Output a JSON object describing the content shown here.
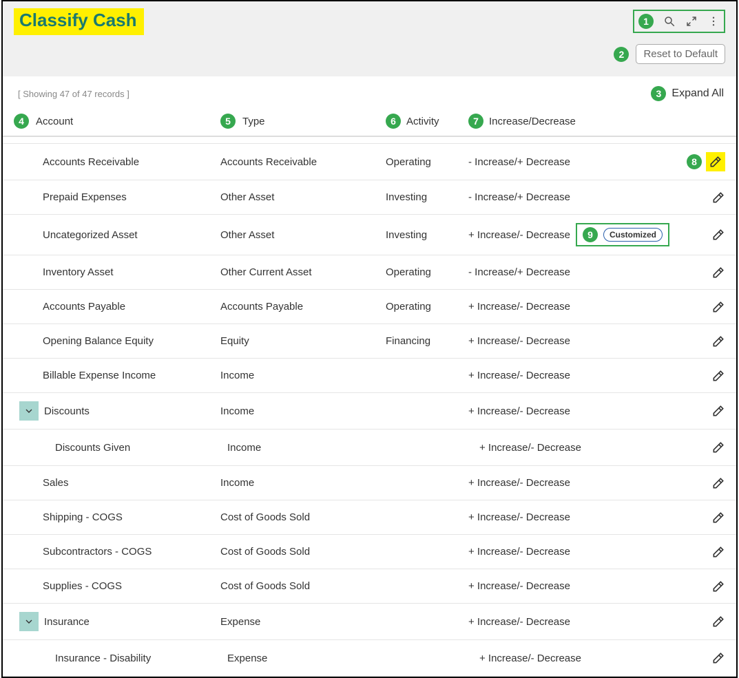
{
  "header": {
    "title": "Classify Cash",
    "reset_label": "Reset to Default"
  },
  "callouts": {
    "toolbar": "1",
    "reset": "2",
    "expand": "3",
    "account": "4",
    "type": "5",
    "activity": "6",
    "incdec": "7",
    "edit": "8",
    "customized": "9"
  },
  "subheader": {
    "record_count": "[ Showing 47 of 47 records ]",
    "expand_all": "Expand All"
  },
  "columns": {
    "account": "Account",
    "type": "Type",
    "activity": "Activity",
    "incdec": "Increase/Decrease"
  },
  "badges": {
    "customized": "Customized"
  },
  "rows": [
    {
      "account": "Accounts Receivable",
      "type": "Accounts Receivable",
      "activity": "Operating",
      "incdec": "- Increase/+ Decrease",
      "indent": 1,
      "first_edit": true
    },
    {
      "account": "Prepaid Expenses",
      "type": "Other Asset",
      "activity": "Investing",
      "incdec": "- Increase/+ Decrease",
      "indent": 1
    },
    {
      "account": "Uncategorized Asset",
      "type": "Other Asset",
      "activity": "Investing",
      "incdec": "+ Increase/- Decrease",
      "indent": 1,
      "customized": true
    },
    {
      "account": "Inventory Asset",
      "type": "Other Current Asset",
      "activity": "Operating",
      "incdec": "- Increase/+ Decrease",
      "indent": 1
    },
    {
      "account": "Accounts Payable",
      "type": "Accounts Payable",
      "activity": "Operating",
      "incdec": "+ Increase/- Decrease",
      "indent": 1
    },
    {
      "account": "Opening Balance Equity",
      "type": "Equity",
      "activity": "Financing",
      "incdec": "+ Increase/- Decrease",
      "indent": 1
    },
    {
      "account": "Billable Expense Income",
      "type": "Income",
      "activity": "",
      "incdec": "+ Increase/- Decrease",
      "indent": 1
    },
    {
      "account": "Discounts",
      "type": "Income",
      "activity": "",
      "incdec": "+ Increase/- Decrease",
      "indent": 0,
      "expandable": true
    },
    {
      "account": "Discounts Given",
      "type": "Income",
      "activity": "",
      "incdec": "+ Increase/- Decrease",
      "indent": 2,
      "child": true
    },
    {
      "account": "Sales",
      "type": "Income",
      "activity": "",
      "incdec": "+ Increase/- Decrease",
      "indent": 1
    },
    {
      "account": "Shipping - COGS",
      "type": "Cost of Goods Sold",
      "activity": "",
      "incdec": "+ Increase/- Decrease",
      "indent": 1
    },
    {
      "account": "Subcontractors - COGS",
      "type": "Cost of Goods Sold",
      "activity": "",
      "incdec": "+ Increase/- Decrease",
      "indent": 1
    },
    {
      "account": "Supplies - COGS",
      "type": "Cost of Goods Sold",
      "activity": "",
      "incdec": "+ Increase/- Decrease",
      "indent": 1
    },
    {
      "account": "Insurance",
      "type": "Expense",
      "activity": "",
      "incdec": "+ Increase/- Decrease",
      "indent": 0,
      "expandable": true
    },
    {
      "account": "Insurance - Disability",
      "type": "Expense",
      "activity": "",
      "incdec": "+ Increase/- Decrease",
      "indent": 2,
      "child": true
    }
  ]
}
